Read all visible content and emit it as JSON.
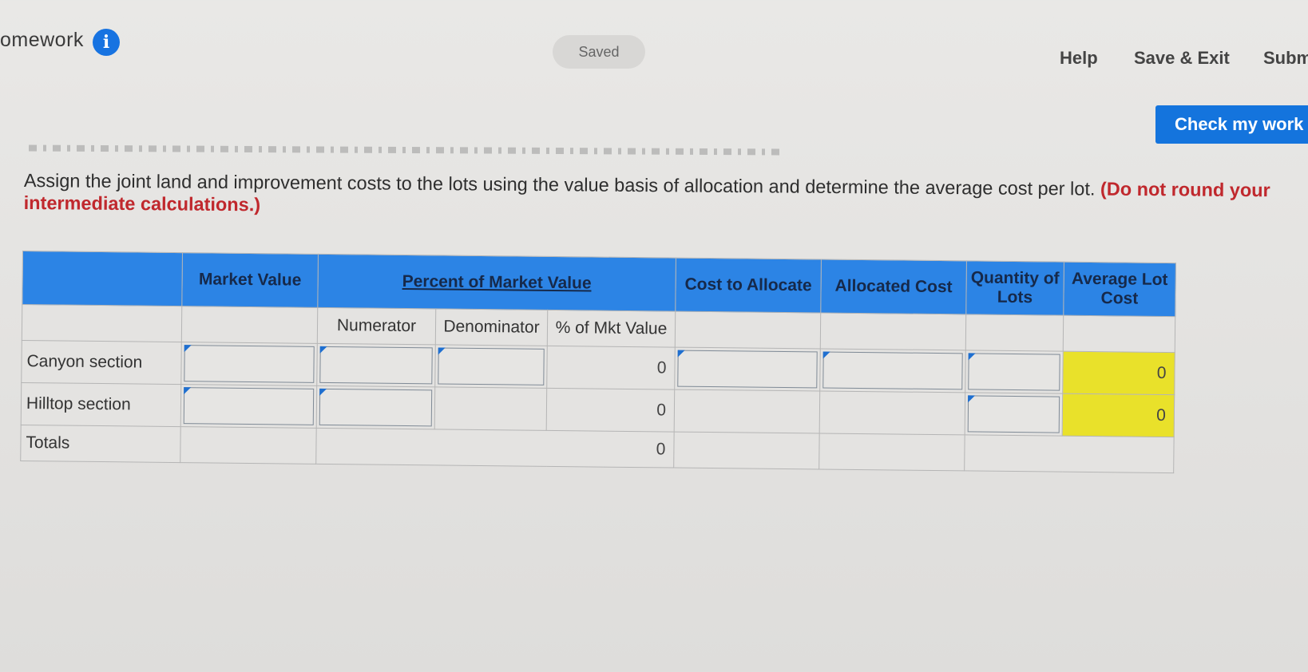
{
  "header": {
    "title": "omework",
    "info_icon": "info-icon",
    "saved_label": "Saved",
    "help_label": "Help",
    "save_exit_label": "Save & Exit",
    "submit_label": "Subm"
  },
  "check_my_work_label": "Check my work",
  "instructions": {
    "text": "Assign the joint land and improvement costs to the lots using the value basis of allocation and determine the average cost per lot.",
    "emphasis": "(Do not round your intermediate calculations.)"
  },
  "table": {
    "headers": {
      "market_value": "Market Value",
      "percent_of_market_value": "Percent of Market Value",
      "cost_to_allocate": "Cost to Allocate",
      "allocated_cost": "Allocated Cost",
      "quantity_of_lots": "Quantity of Lots",
      "average_lot_cost": "Average Lot Cost"
    },
    "subheaders": {
      "numerator": "Numerator",
      "denominator": "Denominator",
      "pct_mkt_value": "% of Mkt Value"
    },
    "rows": [
      {
        "label": "Canyon section",
        "pct_mkt_value": "0",
        "average_lot_cost": "0"
      },
      {
        "label": "Hilltop section",
        "pct_mkt_value": "0",
        "average_lot_cost": "0"
      },
      {
        "label": "Totals",
        "pct_mkt_value": "0"
      }
    ],
    "highlight_color": "#e9e12a",
    "header_color": "#2c84e5"
  }
}
